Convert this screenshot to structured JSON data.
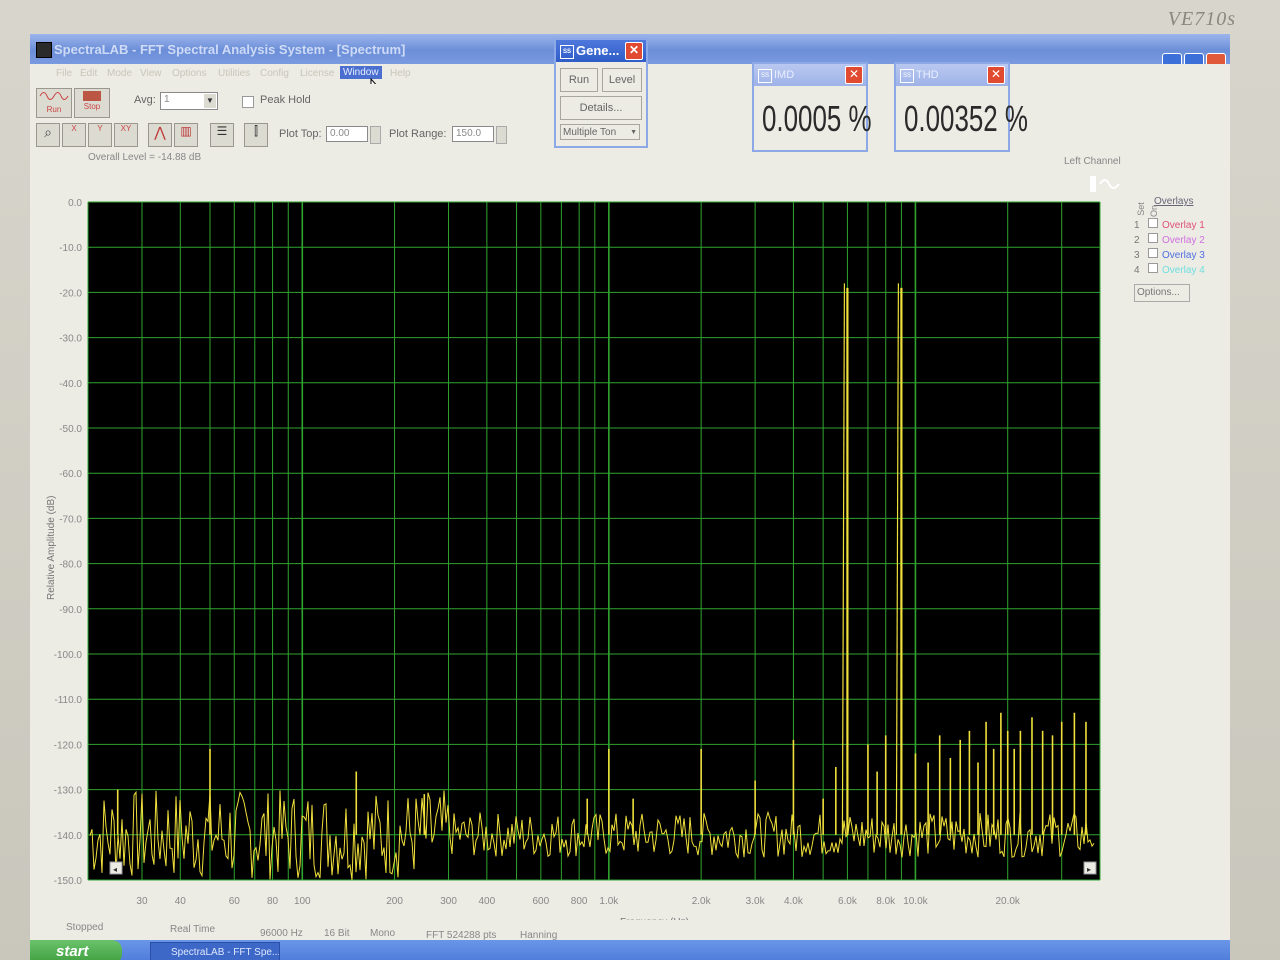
{
  "monitor": {
    "brand": "VE710s"
  },
  "window": {
    "title": "SpectraLAB - FFT Spectral Analysis System - [Spectrum]",
    "menus": [
      "File",
      "Edit",
      "Mode",
      "View",
      "Options",
      "Utilities",
      "Config",
      "License",
      "Window",
      "Help"
    ]
  },
  "toolbar": {
    "run_label": "Run",
    "stop_label": "Stop",
    "avg_label": "Avg:",
    "avg_value": "1",
    "peak_hold_label": "Peak Hold",
    "plot_top_label": "Plot Top:",
    "plot_top_value": "0.00",
    "plot_range_label": "Plot Range:",
    "plot_range_value": "150.0"
  },
  "generator": {
    "title": "Gene...",
    "run_label": "Run",
    "level_label": "Level",
    "details_label": "Details...",
    "mode_value": "Multiple Ton"
  },
  "imd": {
    "title": "IMD",
    "value": "0.0005 %"
  },
  "thd": {
    "title": "THD",
    "value": "0.00352 %"
  },
  "plot": {
    "overall_level": "Overall Level = -14.88 dB",
    "channel": "Left Channel",
    "overlays_header": "Overlays",
    "set_label": "Set",
    "on_label": "On",
    "overlays": [
      {
        "num": "1",
        "name": "Overlay 1",
        "color": "#e0507a"
      },
      {
        "num": "2",
        "name": "Overlay 2",
        "color": "#d070e0"
      },
      {
        "num": "3",
        "name": "Overlay 3",
        "color": "#4f6fe0"
      },
      {
        "num": "4",
        "name": "Overlay 4",
        "color": "#70e0e0"
      }
    ],
    "options_label": "Options..."
  },
  "chart_data": {
    "type": "line",
    "title": "",
    "xlabel": "Frequency (Hz)",
    "ylabel": "Relative Amplitude (dB)",
    "xscale": "log",
    "xlim": [
      20,
      40000
    ],
    "ylim": [
      -150,
      0
    ],
    "grid": true,
    "background": "#000000",
    "grid_color": "#2fa52f",
    "trace_color": "#f0e03c",
    "y_ticks": [
      "0.0",
      "-10.0",
      "-20.0",
      "-30.0",
      "-40.0",
      "-50.0",
      "-60.0",
      "-70.0",
      "-80.0",
      "-90.0",
      "-100.0",
      "-110.0",
      "-120.0",
      "-130.0",
      "-140.0",
      "-150.0"
    ],
    "x_tick_labels": [
      {
        "f": 30,
        "label": "30"
      },
      {
        "f": 40,
        "label": "40"
      },
      {
        "f": 60,
        "label": "60"
      },
      {
        "f": 80,
        "label": "80"
      },
      {
        "f": 100,
        "label": "100"
      },
      {
        "f": 200,
        "label": "200"
      },
      {
        "f": 300,
        "label": "300"
      },
      {
        "f": 400,
        "label": "400"
      },
      {
        "f": 600,
        "label": "600"
      },
      {
        "f": 800,
        "label": "800"
      },
      {
        "f": 1000,
        "label": "1.0k"
      },
      {
        "f": 2000,
        "label": "2.0k"
      },
      {
        "f": 3000,
        "label": "3.0k"
      },
      {
        "f": 4000,
        "label": "4.0k"
      },
      {
        "f": 6000,
        "label": "6.0k"
      },
      {
        "f": 8000,
        "label": "8.0k"
      },
      {
        "f": 10000,
        "label": "10.0k"
      },
      {
        "f": 20000,
        "label": "20.0k"
      }
    ],
    "noise_floor_db": -140,
    "peaks": [
      {
        "f": 25,
        "db": -130
      },
      {
        "f": 50,
        "db": -121
      },
      {
        "f": 150,
        "db": -126
      },
      {
        "f": 250,
        "db": -131
      },
      {
        "f": 850,
        "db": -132
      },
      {
        "f": 1000,
        "db": -121
      },
      {
        "f": 1200,
        "db": -132
      },
      {
        "f": 2000,
        "db": -121
      },
      {
        "f": 3000,
        "db": -128
      },
      {
        "f": 4000,
        "db": -119
      },
      {
        "f": 5000,
        "db": -132
      },
      {
        "f": 5500,
        "db": -125
      },
      {
        "f": 6000,
        "db": -19
      },
      {
        "f": 7000,
        "db": -120
      },
      {
        "f": 7500,
        "db": -126
      },
      {
        "f": 8000,
        "db": -118
      },
      {
        "f": 9000,
        "db": -19
      },
      {
        "f": 10000,
        "db": -122
      },
      {
        "f": 11000,
        "db": -124
      },
      {
        "f": 12000,
        "db": -118
      },
      {
        "f": 13000,
        "db": -123
      },
      {
        "f": 14000,
        "db": -119
      },
      {
        "f": 15000,
        "db": -117
      },
      {
        "f": 16000,
        "db": -124
      },
      {
        "f": 17000,
        "db": -115
      },
      {
        "f": 18000,
        "db": -121
      },
      {
        "f": 19000,
        "db": -113
      },
      {
        "f": 20000,
        "db": -117
      },
      {
        "f": 21000,
        "db": -121
      },
      {
        "f": 22000,
        "db": -117
      },
      {
        "f": 24000,
        "db": -114
      },
      {
        "f": 26000,
        "db": -117
      },
      {
        "f": 28000,
        "db": -118
      },
      {
        "f": 30000,
        "db": -115
      },
      {
        "f": 33000,
        "db": -113
      },
      {
        "f": 36000,
        "db": -115
      }
    ]
  },
  "status": {
    "state": "Stopped",
    "mode": "Real Time",
    "rate": "96000 Hz",
    "bits": "16 Bit",
    "channels": "Mono",
    "fft": "FFT 524288 pts",
    "window": "Hanning"
  },
  "taskbar": {
    "start_label": "start",
    "task_label": "SpectraLAB - FFT Spe..."
  }
}
